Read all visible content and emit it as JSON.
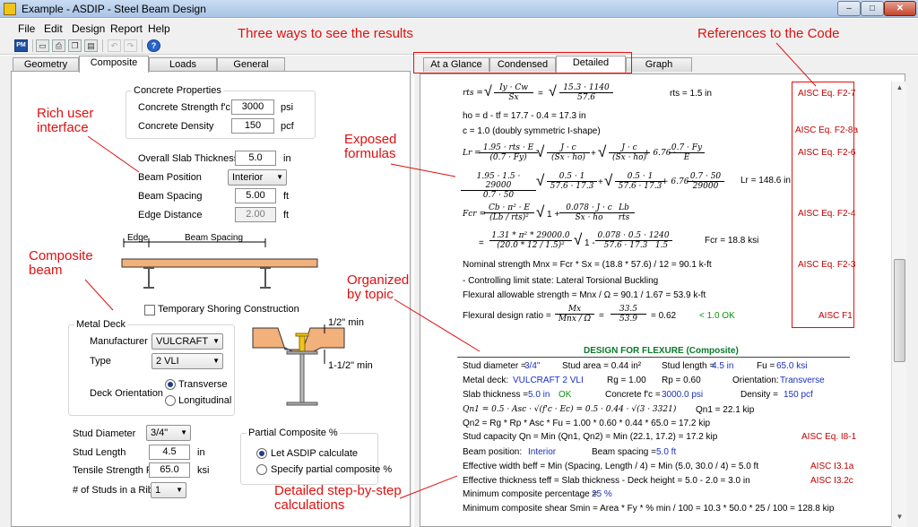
{
  "window": {
    "title": "Example - ASDIP - Steel Beam Design",
    "app_icon": "ASDIP",
    "minimize": "–",
    "maximize": "□",
    "close": "✕"
  },
  "menu": [
    "File",
    "Edit",
    "Design",
    "Report",
    "Help"
  ],
  "toolbar": {
    "pm": "PM",
    "help": "?"
  },
  "left_tabs": [
    "Geometry",
    "Composite",
    "Loads",
    "General"
  ],
  "right_tabs": [
    "At a Glance",
    "Condensed",
    "Detailed",
    "Graph"
  ],
  "concrete": {
    "group_title": "Concrete Properties",
    "strength_label": "Concrete Strength f'c",
    "strength_value": "3000",
    "strength_unit": "psi",
    "density_label": "Concrete Density",
    "density_value": "150",
    "density_unit": "pcf"
  },
  "slab": {
    "thickness_label": "Overall Slab Thickness",
    "thickness_value": "5.0",
    "thickness_unit": "in",
    "position_label": "Beam Position",
    "position_value": "Interior",
    "spacing_label": "Beam Spacing",
    "spacing_value": "5.00",
    "spacing_unit": "ft",
    "edge_label": "Edge Distance",
    "edge_value": "2.00",
    "edge_unit": "ft"
  },
  "sketch": {
    "edge": "Edge",
    "beam_spacing": "Beam Spacing"
  },
  "shoring_label": "Temporary Shoring Construction",
  "deck": {
    "group_title": "Metal Deck",
    "manufacturer_label": "Manufacturer",
    "manufacturer_value": "VULCRAFT",
    "type_label": "Type",
    "type_value": "2 VLI",
    "orientation_label": "Deck Orientation",
    "transverse": "Transverse",
    "longitudinal": "Longitudinal",
    "dim_top": "1/2\" min",
    "dim_bottom": "1-1/2\" min"
  },
  "stud": {
    "diameter_label": "Stud Diameter",
    "diameter_value": "3/4\"",
    "length_label": "Stud Length",
    "length_value": "4.5",
    "length_unit": "in",
    "strength_label": "Tensile Strength  Fu",
    "strength_value": "65.0",
    "strength_unit": "ksi",
    "rib_label": "# of Studs in a Rib",
    "rib_value": "1"
  },
  "partial": {
    "group_title": "Partial Composite %",
    "opt1": "Let ASDIP calculate",
    "opt2": "Specify partial composite %"
  },
  "report": {
    "rts_lhs": "rts =",
    "rts_f1_num": "Iy · Cw",
    "rts_f1_den": "Sx",
    "rts_f2_num": "15.3 · 1140",
    "rts_f2_den": "57.6",
    "rts_result": "rts = 1.5 in",
    "ho_line": "ho = d - tf =  17.7 - 0.4 = 17.3 in",
    "c_line": "c = 1.0    (doubly symmetric I-shape)",
    "lr_lhs": "Lr =",
    "lr_f1_num": "1.95 · rts · E",
    "lr_f1_den": "(0.7 · Fy)",
    "lr_f2_num": "J · c",
    "lr_f2_den": "(Sx · ho)",
    "lr_f3_num": "J · c",
    "lr_f3_den": "(Sx · ho)",
    "lr_f4_num": "0.7 · Fy",
    "lr_f4_den": "E",
    "lr_plus": "+ 6.76 ·",
    "lr_n1_num": "1.95 · 1.5 · 29000",
    "lr_n1_den": "0.7 · 50",
    "lr_n2_num": "0.5 · 1",
    "lr_n2_den": "57.6 · 17.3",
    "lr_n3_num": "0.5 · 1",
    "lr_n3_den": "57.6 · 17.3",
    "lr_n4_num": "0.7 · 50",
    "lr_n4_den": "29000",
    "lr_result": "Lr = 148.6 in",
    "fcr_lhs": "Fcr =",
    "fcr_f1_num": "Cb · π² · E",
    "fcr_f1_den": "(Lb / rts)²",
    "fcr_f2_num": "0.078 · J · c",
    "fcr_f2_den": "Sx · ho",
    "fcr_f3_num": "Lb",
    "fcr_f3_den": "rts",
    "fcr_n1_num": "1.31 * π² * 29000.0",
    "fcr_n1_den": "(20.0 * 12 / 1.5)²",
    "fcr_n2_num": "0.078 · 0.5 · 1",
    "fcr_n2_den": "57.6 · 17.3",
    "fcr_n3_num": "240",
    "fcr_n3_den": "1.5",
    "fcr_result": "Fcr = 18.8 ksi",
    "nominal": "Nominal strength    Mnx = Fcr * Sx = (18.8 * 57.6) / 12 = 90.1 k-ft",
    "controlling": "- Controlling limit state:  Lateral Torsional Buckling",
    "allowable": "Flexural allowable strength =  Mnx / Ω =  90.1 / 1.67 = 53.9 k-ft",
    "ratio_label": "Flexural design ratio =",
    "ratio_f1_num": "Mx",
    "ratio_f1_den": "Mnx / Ω",
    "ratio_f2_num": "33.5",
    "ratio_f2_den": "53.9",
    "ratio_value": "= 0.62",
    "ratio_ok": "< 1.0  OK",
    "design_header": "DESIGN FOR FLEXURE (Composite)",
    "stud_dia_l": "Stud diameter =",
    "stud_dia_v": "3/4\"",
    "stud_area": "Stud area = 0.44 in²",
    "stud_len_l": "Stud length =",
    "stud_len_v": "4.5 in",
    "fu_l": "Fu =",
    "fu_v": "65.0 ksi",
    "deck_l": "Metal deck:",
    "deck_v": "VULCRAFT  2 VLI",
    "rg": "Rg = 1.00",
    "rp": "Rp = 0.60",
    "orient_l": "Orientation:",
    "orient_v": "Transverse",
    "slab_l": "Slab thickness =",
    "slab_v": "5.0 in",
    "slab_ok": "OK",
    "fc_l": "Concrete f'c =",
    "fc_v": "3000.0 psi",
    "dens_l": "Density =",
    "dens_v": "150 pcf",
    "qn1_formula": "Qn1 = 0.5 · Asc · √(f'c · Ec)  =  0.5 · 0.44 · √(3 · 3321)",
    "qn1_result": "Qn1 = 22.1 kip",
    "qn2": "Qn2 = Rg * Rp * Asc * Fu =  1.00 * 0.60 * 0.44 * 65.0 = 17.2 kip",
    "capacity": "Stud capacity   Qn = Min (Qn1, Qn2) = Min (22.1, 17.2) = 17.2 kip",
    "beampos_l": "Beam position:",
    "beampos_v": "Interior",
    "beamsp_l": "Beam spacing =",
    "beamsp_v": "5.0 ft",
    "effw": "Effective width   beff = Min (Spacing, Length / 4) =  Min (5.0, 30.0 / 4) = 5.0 ft",
    "efft": "Effective thickness   teff = Slab thickness - Deck height = 5.0 - 2.0 = 3.0 in",
    "mincomp_l": "Minimum composite percentage =",
    "mincomp_v": "25 %",
    "minshear": "Minimum composite shear    Smin = Area * Fy * % min / 100 =  10.3 * 50.0 * 25 / 100 = 128.8 kip"
  },
  "codes": [
    "AISC Eq. F2-7",
    "AISC Eq. F2-8a",
    "AISC Eq. F2-6",
    "AISC Eq. F2-4",
    "AISC Eq. F2-3",
    "AISC F1",
    "AISC Eq. I8-1",
    "AISC I3.1a",
    "AISC I3.2c"
  ],
  "annotations": {
    "three_ways": "Three ways to see the results",
    "references": "References to the Code",
    "rich_ui_1": "Rich user",
    "rich_ui_2": "interface",
    "exposed_1": "Exposed",
    "exposed_2": "formulas",
    "composite_1": "Composite",
    "composite_2": "beam",
    "organized_1": "Organized",
    "organized_2": "by topic",
    "detailed_1": "Detailed step-by-step",
    "detailed_2": "calculations"
  },
  "colors": {
    "annotation": "#e01010",
    "code_ref": "#c00000",
    "value_blue": "#1a2fc0",
    "ok_green": "#109010",
    "header_green": "#0a7a2a",
    "beam_orange": "#f2b07a"
  }
}
